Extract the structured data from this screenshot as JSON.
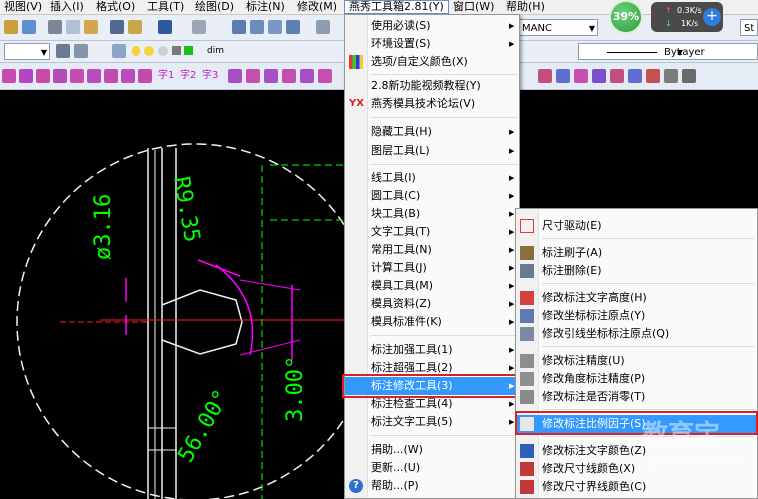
{
  "menubar": {
    "items": [
      {
        "label": "视图(V)"
      },
      {
        "label": "插入(I)"
      },
      {
        "label": "格式(O)"
      },
      {
        "label": "工具(T)"
      },
      {
        "label": "绘图(D)"
      },
      {
        "label": "标注(N)"
      },
      {
        "label": "修改(M)"
      },
      {
        "label": "燕秀工具箱2.81(Y)"
      },
      {
        "label": "窗口(W)"
      },
      {
        "label": "帮助(H)"
      }
    ]
  },
  "toolbar": {
    "textstyle_value": "MANC",
    "style_value": "St",
    "layer_value": "dim",
    "linetype_value": "ByLayer",
    "text_buttons": [
      "字1",
      "字2",
      "字3"
    ]
  },
  "perf_badge": {
    "percent": "39%",
    "up_speed": "0.3K/s",
    "down_speed": "1K/s"
  },
  "drawing": {
    "labels": {
      "dim_radius": "R9.35",
      "dim_diameter": "ø3.16",
      "dim_angle": "56.00°",
      "dim_len": "3.00°"
    }
  },
  "main_menu": {
    "items": [
      {
        "label": "使用必读(S)",
        "submenu": true
      },
      {
        "label": "环境设置(S)",
        "submenu": true
      },
      {
        "label": "选项/自定义颜色(X)",
        "submenu": false,
        "icon": "color-palette-icon"
      },
      {
        "label": "2.8新功能视频教程(Y)",
        "submenu": false
      },
      {
        "label": "燕秀模具技术论坛(V)",
        "submenu": false,
        "icon": "yx-logo-icon",
        "icon_text": "YX"
      },
      {
        "label": "隐藏工具(H)",
        "submenu": true
      },
      {
        "label": "图层工具(L)",
        "submenu": true
      },
      {
        "label": "线工具(I)",
        "submenu": true
      },
      {
        "label": "圆工具(C)",
        "submenu": true
      },
      {
        "label": "块工具(B)",
        "submenu": true
      },
      {
        "label": "文字工具(T)",
        "submenu": true
      },
      {
        "label": "常用工具(N)",
        "submenu": true
      },
      {
        "label": "计算工具(J)",
        "submenu": true
      },
      {
        "label": "模具工具(M)",
        "submenu": true
      },
      {
        "label": "模具资料(Z)",
        "submenu": true
      },
      {
        "label": "模具标准件(K)",
        "submenu": true
      },
      {
        "label": "标注加强工具(1)",
        "submenu": true
      },
      {
        "label": "标注超强工具(2)",
        "submenu": true
      },
      {
        "label": "标注修改工具(3)",
        "submenu": true,
        "selected": true
      },
      {
        "label": "标注检查工具(4)",
        "submenu": true
      },
      {
        "label": "标注文字工具(5)",
        "submenu": true
      },
      {
        "label": "捐助...(W)",
        "submenu": false
      },
      {
        "label": "更新...(U)",
        "submenu": false
      },
      {
        "label": "帮助...(P)",
        "submenu": false,
        "icon": "help-icon"
      }
    ]
  },
  "sub_menu": {
    "items": [
      {
        "label": "尺寸驱动(E)",
        "icon": "dimension-drive-icon"
      },
      {
        "label": "标注刷子(A)",
        "icon": "brush-icon"
      },
      {
        "label": "标注删除(E)",
        "icon": "delete-dimension-icon"
      },
      {
        "label": "修改标注文字高度(H)",
        "icon": "text-height-icon"
      },
      {
        "label": "修改坐标标注原点(Y)",
        "icon": "coordinate-origin-icon"
      },
      {
        "label": "修改引线坐标标注原点(Q)",
        "icon": "leader-origin-icon"
      },
      {
        "label": "修改标注精度(U)",
        "icon": "precision-icon"
      },
      {
        "label": "修改角度标注精度(P)",
        "icon": "angle-precision-icon"
      },
      {
        "label": "修改标注是否消零(T)",
        "icon": "zero-suppress-icon"
      },
      {
        "label": "修改标注比例因子(S)",
        "icon": "scale-factor-icon",
        "selected": true
      },
      {
        "label": "修改标注文字颜色(Z)",
        "icon": "text-color-icon"
      },
      {
        "label": "修改尺寸线颜色(X)",
        "icon": "dimline-color-icon"
      },
      {
        "label": "修改尺寸界线颜色(C)",
        "icon": "extline-color-icon"
      }
    ]
  },
  "watermark": {
    "main": "教育宝",
    "url": "JIAOYUBAO.CN"
  },
  "colors": {
    "menu_highlight": "#3399ff",
    "callout": "#e02020",
    "dimension_green": "#00ff00",
    "dimension_magenta": "#ff00ff"
  }
}
